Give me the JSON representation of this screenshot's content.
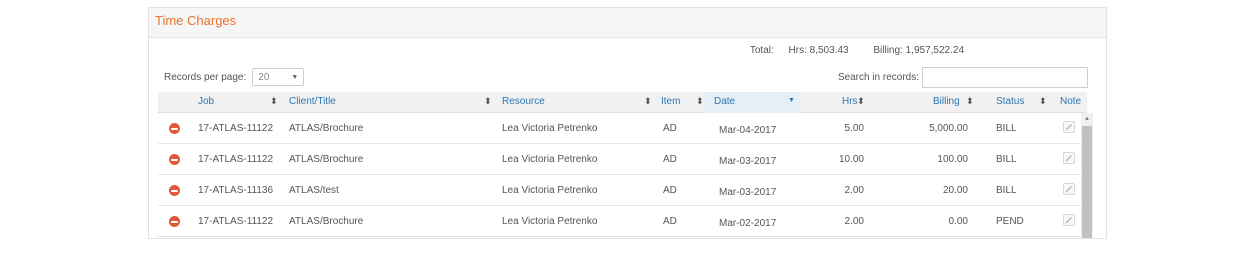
{
  "panel": {
    "title": "Time Charges"
  },
  "totals": {
    "label": "Total:",
    "hrs": "Hrs: 8,503.43",
    "billing": "Billing: 1,957,522.24"
  },
  "records_per_page": {
    "label": "Records per page:",
    "value": "20"
  },
  "search": {
    "label": "Search in records:",
    "value": ""
  },
  "columns": {
    "job": "Job",
    "client": "Client/Title",
    "resource": "Resource",
    "item": "Item",
    "date": "Date",
    "hrs": "Hrs",
    "billing": "Billing",
    "status": "Status",
    "note": "Note"
  },
  "sort_icons": {
    "unsorted": "⬍",
    "sorted_desc": "▼"
  },
  "rows": [
    {
      "job": "17-ATLAS-11122",
      "client": "ATLAS/Brochure",
      "resource": "Lea Victoria Petrenko",
      "item": "AD",
      "date": "Mar-04-2017",
      "hrs": "5.00",
      "billing": "5,000.00",
      "status": "BILL"
    },
    {
      "job": "17-ATLAS-11122",
      "client": "ATLAS/Brochure",
      "resource": "Lea Victoria Petrenko",
      "item": "AD",
      "date": "Mar-03-2017",
      "hrs": "10.00",
      "billing": "100.00",
      "status": "BILL"
    },
    {
      "job": "17-ATLAS-11136",
      "client": "ATLAS/test",
      "resource": "Lea Victoria Petrenko",
      "item": "AD",
      "date": "Mar-03-2017",
      "hrs": "2.00",
      "billing": "20.00",
      "status": "BILL"
    },
    {
      "job": "17-ATLAS-11122",
      "client": "ATLAS/Brochure",
      "resource": "Lea Victoria Petrenko",
      "item": "AD",
      "date": "Mar-02-2017",
      "hrs": "2.00",
      "billing": "0.00",
      "status": "PEND"
    }
  ],
  "icons": {
    "delete": "delete-icon",
    "note": "note-icon",
    "caret": "caret-down-icon"
  },
  "colors": {
    "title": "#e8722c",
    "link": "#2f76b6",
    "delete": "#e05a3a"
  }
}
